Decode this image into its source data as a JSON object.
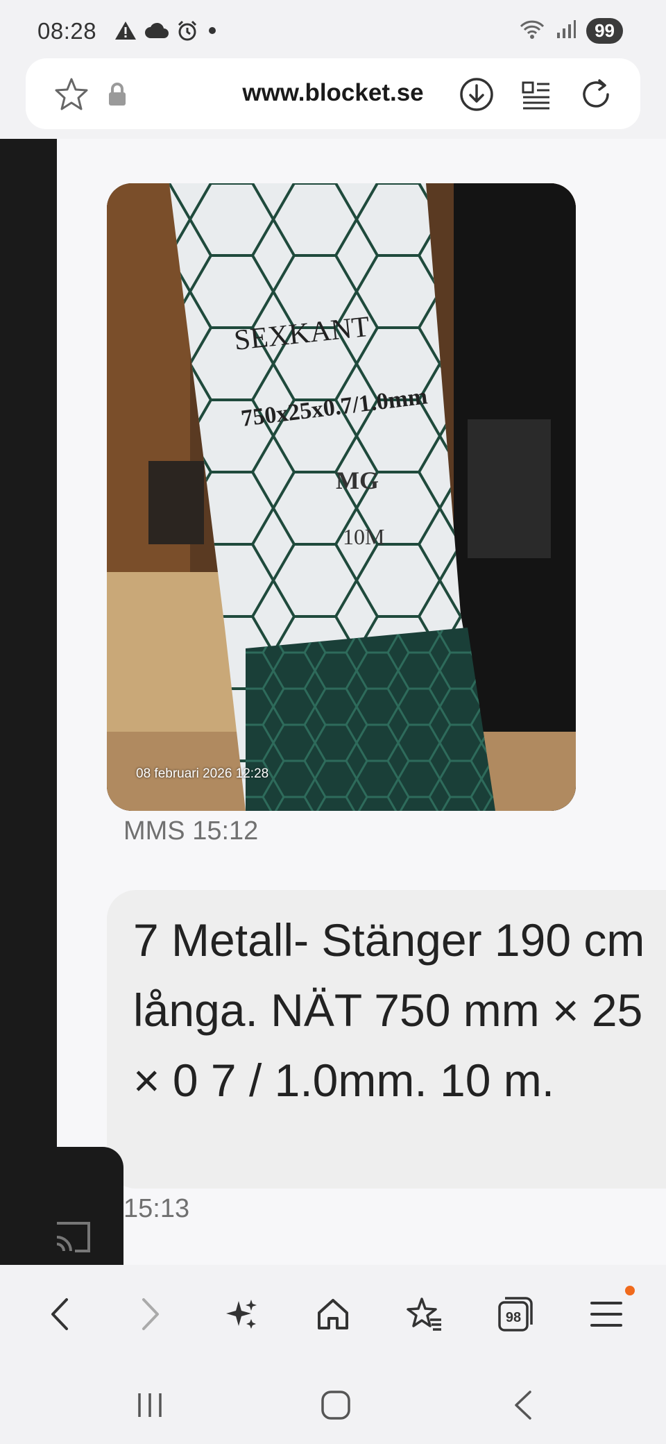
{
  "status_bar": {
    "time": "08:28",
    "battery": "99",
    "icons": [
      "warning-icon",
      "cloud-icon",
      "alarm-icon",
      "dot-icon",
      "wifi-icon",
      "signal-icon"
    ]
  },
  "browser": {
    "url": "www.blocket.se",
    "icons": [
      "star-icon",
      "lock-icon",
      "download-icon",
      "reader-icon",
      "reload-icon"
    ]
  },
  "message_photo": {
    "stamp": "08 februari 2026 12:28",
    "label_lines": [
      "SEXKANT",
      "750x25x0.7/1.0mm",
      "MG",
      "10M"
    ]
  },
  "mms_meta": "MMS 15:12",
  "message_text": "7 Metall- Stänger 190 cm långa. NÄT 750 mm × 25 × 0 7 / 1.0mm. 10 m.",
  "message_time": "15:13",
  "toolbar": {
    "tabs_count": "98",
    "icons": [
      "back-icon",
      "forward-icon",
      "sparkle-icon",
      "home-icon",
      "bookmarks-icon",
      "tabs-icon",
      "menu-icon"
    ]
  },
  "colors": {
    "accent_dot": "#f06a1c",
    "bubble": "#eeeeee",
    "dark_panel": "#1a1a1a"
  }
}
